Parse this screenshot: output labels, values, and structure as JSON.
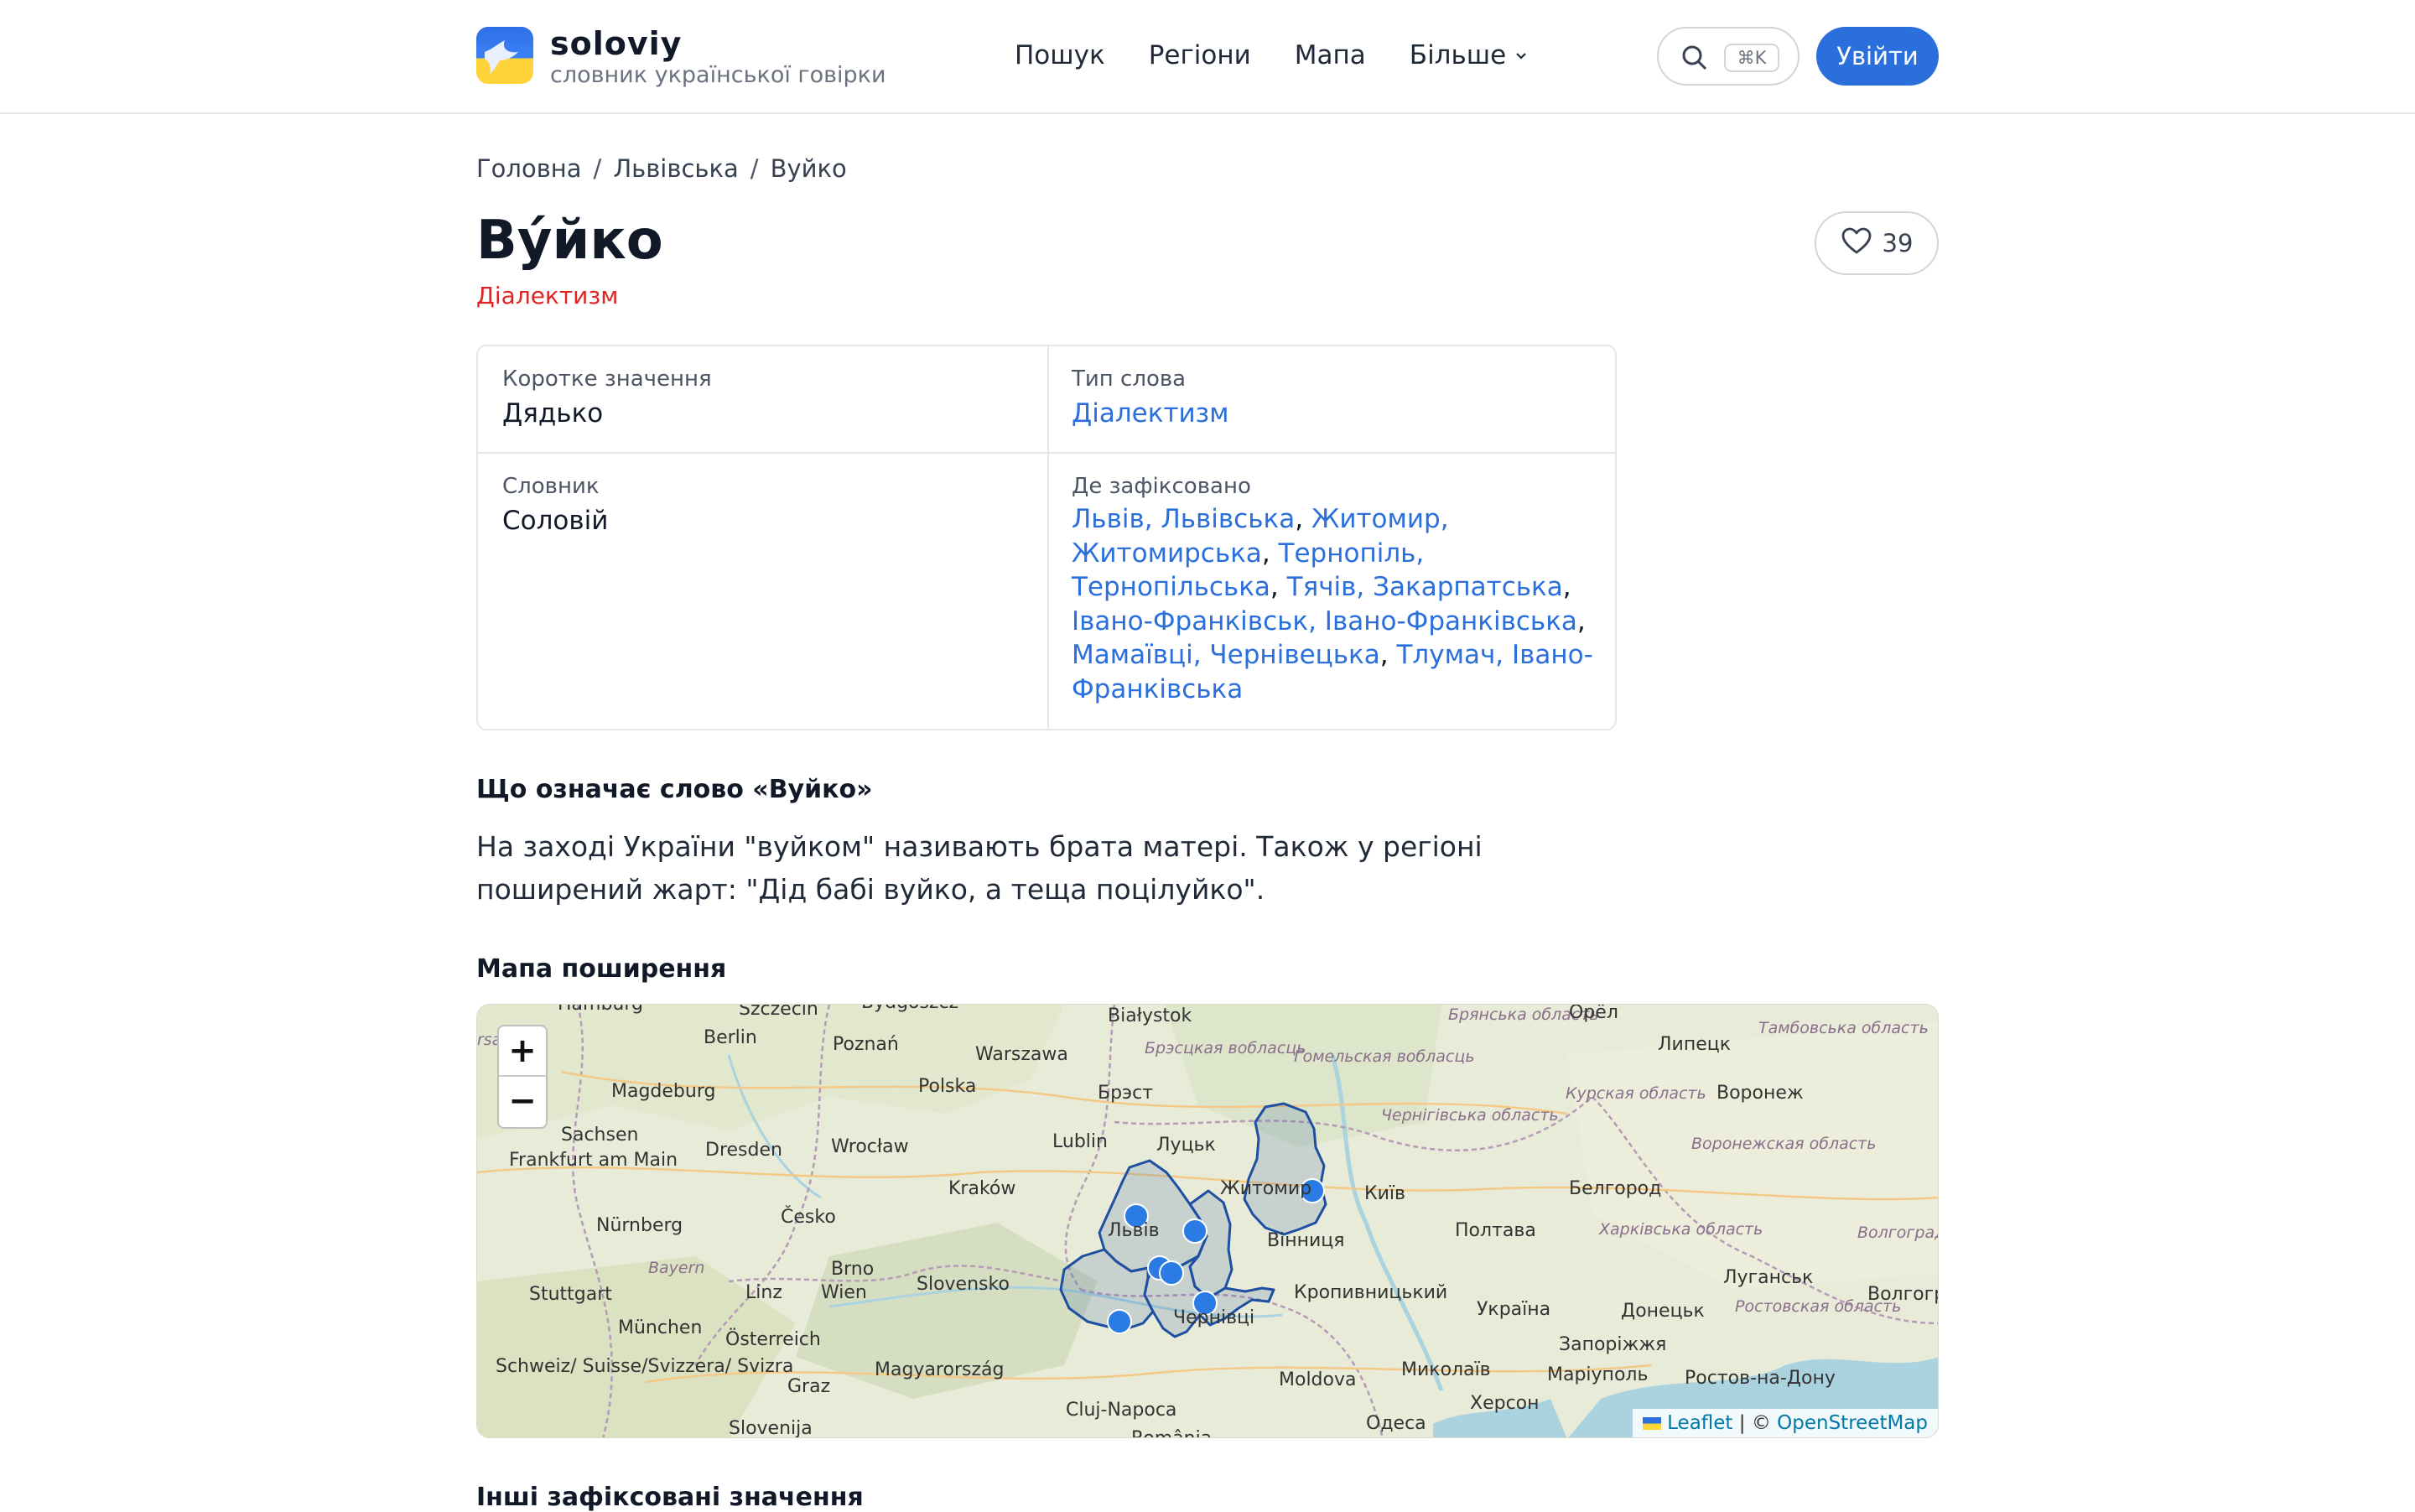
{
  "header": {
    "brand_name": "soloviy",
    "brand_sub": "словник української говірки",
    "nav": [
      {
        "label": "Пошук"
      },
      {
        "label": "Регіони"
      },
      {
        "label": "Мапа"
      },
      {
        "label": "Більше"
      }
    ],
    "search_shortcut": "⌘K",
    "login_label": "Увійти"
  },
  "breadcrumb": [
    "Головна",
    "Львівська",
    "Вуйко"
  ],
  "word": {
    "title": "Ву́йко",
    "type": "Діалектизм",
    "likes": "39"
  },
  "info": {
    "short_meaning_label": "Коротке значення",
    "short_meaning": "Дядько",
    "word_type_label": "Тип слова",
    "word_type": "Діалектизм",
    "dictionary_label": "Словник",
    "dictionary": "Соловій",
    "recorded_label": "Де зафіксовано",
    "places": [
      "Львів, Львівська",
      "Житомир, Житомирська",
      "Тернопіль, Тернопільська",
      "Тячів, Закарпатська",
      "Івано-Франківськ, Івано-Франківська",
      "Мамаївці, Чернівецька",
      "Тлумач, Івано-Франківська"
    ]
  },
  "meaning": {
    "heading": "Що означає слово «Вуйко»",
    "text": "На заході України \"вуйком\" називають брата матері. Також у регіоні поширений жарт: \"Дід бабі вуйко, а теща поцілуйко\"."
  },
  "map": {
    "heading": "Мапа поширення",
    "zoom_in": "+",
    "zoom_out": "−",
    "attribution_leaflet": "Leaflet",
    "attribution_sep": "| ©",
    "attribution_osm": "OpenStreetMap",
    "region_color": "#1e4fa0",
    "marker_color": "#2b7be4",
    "labels": {
      "hamburg": "Hamburg",
      "szczecin": "Szczecin",
      "bydgoszcz": "Bydgoszcz",
      "bialystok": "Białystok",
      "bryansk": "Брянська область",
      "orel": "Орёл",
      "tambov": "Тамбовська область",
      "sachsen": "rsachsen",
      "berlin": "Berlin",
      "poznan": "Poznań",
      "warszawa": "Warszawa",
      "brest_obl": "Брэсцкая вобласць",
      "gomel": "Гомельская вобласць",
      "lipetsk": "Липецк",
      "magdeburg": "Magdeburg",
      "polska": "Polska",
      "brest": "Брэст",
      "kursk": "Курская область",
      "voronezh": "Воронеж",
      "sachsen2": "Sachsen",
      "dresden": "Dresden",
      "wroclaw": "Wrocław",
      "lublin": "Lublin",
      "lutsk": "Луцьк",
      "chernihiv": "Чернігівська область",
      "frankfurt": "Frankfurt am Main",
      "voronezh_obl": "Воронежская область",
      "krakow": "Kraków",
      "zhytomyr": "Житомир",
      "kyiv": "Київ",
      "belgorod": "Белгород",
      "cesko": "Česko",
      "lviv": "Львів",
      "vinnytsia": "Вінниця",
      "poltava": "Полтава",
      "nurnberg": "Nürnberg",
      "kharkiv": "Харківська область",
      "volgograd": "Волгоград область",
      "bayern": "Bayern",
      "brno": "Brno",
      "slovensko": "Slovensko",
      "kropyvnytskyi": "Кропивницький",
      "luhansk": "Луганськ",
      "stuttgart": "Stuttgart",
      "linz": "Linz",
      "wien": "Wien",
      "chernivtsi": "Чернівці",
      "ukraina": "Україна",
      "donetsk": "Донецьк",
      "rostov": "Ростовская область",
      "volgograd2": "Волгогр",
      "munchen": "München",
      "osterreich": "Österreich",
      "zaporizhzhia": "Запоріжжя",
      "schweiz": "Schweiz/ Suisse/Svizzera/ Svizra",
      "graz": "Graz",
      "magyarorszag": "Magyarország",
      "moldova": "Moldova",
      "mykolaiv": "Миколаїв",
      "mariupol": "Маріуполь",
      "rostov_city": "Ростов-на-Дону",
      "kherson": "Херсон",
      "cluj": "Cluj-Napoca",
      "odesa": "Одеса",
      "slovenija": "Slovenija",
      "romania": "România"
    }
  },
  "other_meanings": {
    "heading": "Інші зафіксовані значення"
  }
}
